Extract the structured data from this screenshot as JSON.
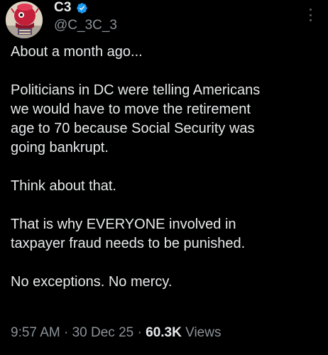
{
  "author": {
    "display_name": "C3",
    "handle": "@C_3C_3",
    "verified": true,
    "verified_color": "#1d9bf0"
  },
  "icons": {
    "avatar": "avatar-image",
    "verified": "verified-badge-icon",
    "more": "more-options-icon"
  },
  "post": {
    "paragraphs": [
      "About a month ago...",
      "Politicians in DC were telling Americans\nwe would have to move the retirement\nage to 70 because Social Security was\ngoing bankrupt.",
      "Think about that.",
      "That is why EVERYONE involved in\ntaxpayer fraud needs to be punished.",
      "No exceptions. No mercy."
    ]
  },
  "meta": {
    "time": "9:57 AM",
    "separator": " · ",
    "date": "30 Dec 25",
    "views_count": "60.3K",
    "views_label": "Views"
  },
  "colors": {
    "background": "#000000",
    "text": "#e7e9ea",
    "secondary_text": "#8b9298"
  }
}
